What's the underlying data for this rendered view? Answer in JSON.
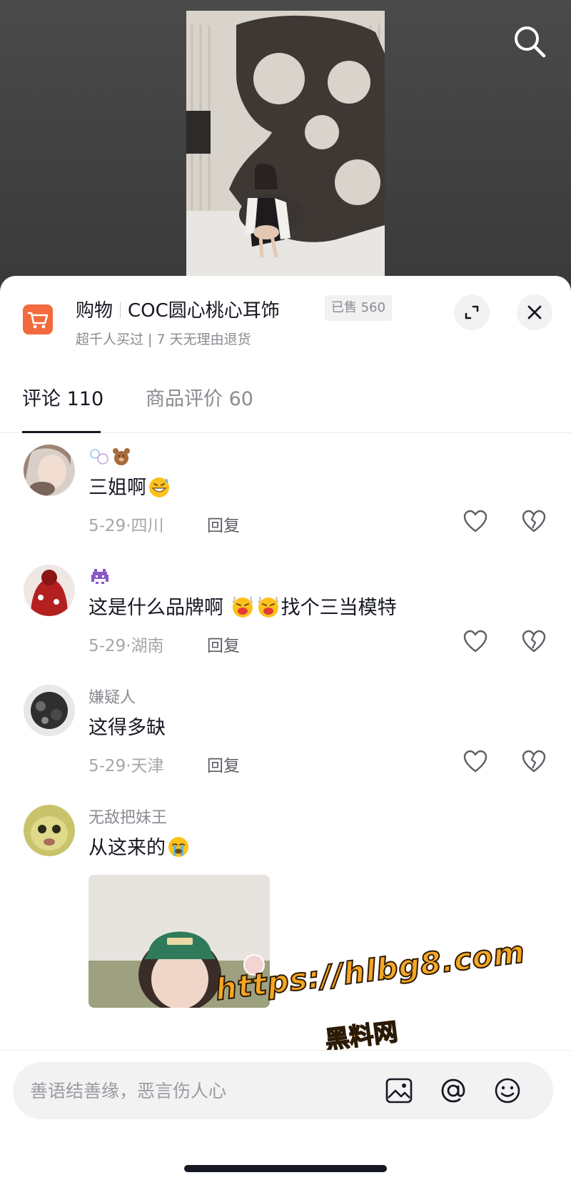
{
  "shop": {
    "category": "购物",
    "product_title": "COC圆心桃心耳饰",
    "sold_label": "已售 560",
    "subtitle": "超千人买过 | 7 天无理由退货",
    "accent_color": "#f26a3d"
  },
  "tabs": [
    {
      "label": "评论 110",
      "active": true
    },
    {
      "label": "商品评价 60",
      "active": false
    }
  ],
  "comments": [
    {
      "name_icons": [
        "bubbles-icon",
        "teddy-bear-icon"
      ],
      "text": "三姐啊",
      "emojis_after": [
        "grin-sweat-emoji"
      ],
      "date": "5-29",
      "location": "四川",
      "reply_label": "回复"
    },
    {
      "name_icons": [
        "alien-monster-icon"
      ],
      "text_parts": [
        "这是什么品牌啊",
        "找个三当模特"
      ],
      "emojis_mid": [
        "steam-face-emoji",
        "steam-face-emoji"
      ],
      "date": "5-29",
      "location": "湖南",
      "reply_label": "回复"
    },
    {
      "name": "嫌疑人",
      "text": "这得多缺",
      "date": "5-29",
      "location": "天津",
      "reply_label": "回复"
    },
    {
      "name": "无敌把妹王",
      "text": "从这来的",
      "emojis_after": [
        "crying-face-emoji"
      ]
    }
  ],
  "meta_separator": "·",
  "watermark": {
    "url": "https://hlbg8.com",
    "name": "黑料网"
  },
  "input": {
    "placeholder": "善语结善缘，恶言伤人心"
  }
}
